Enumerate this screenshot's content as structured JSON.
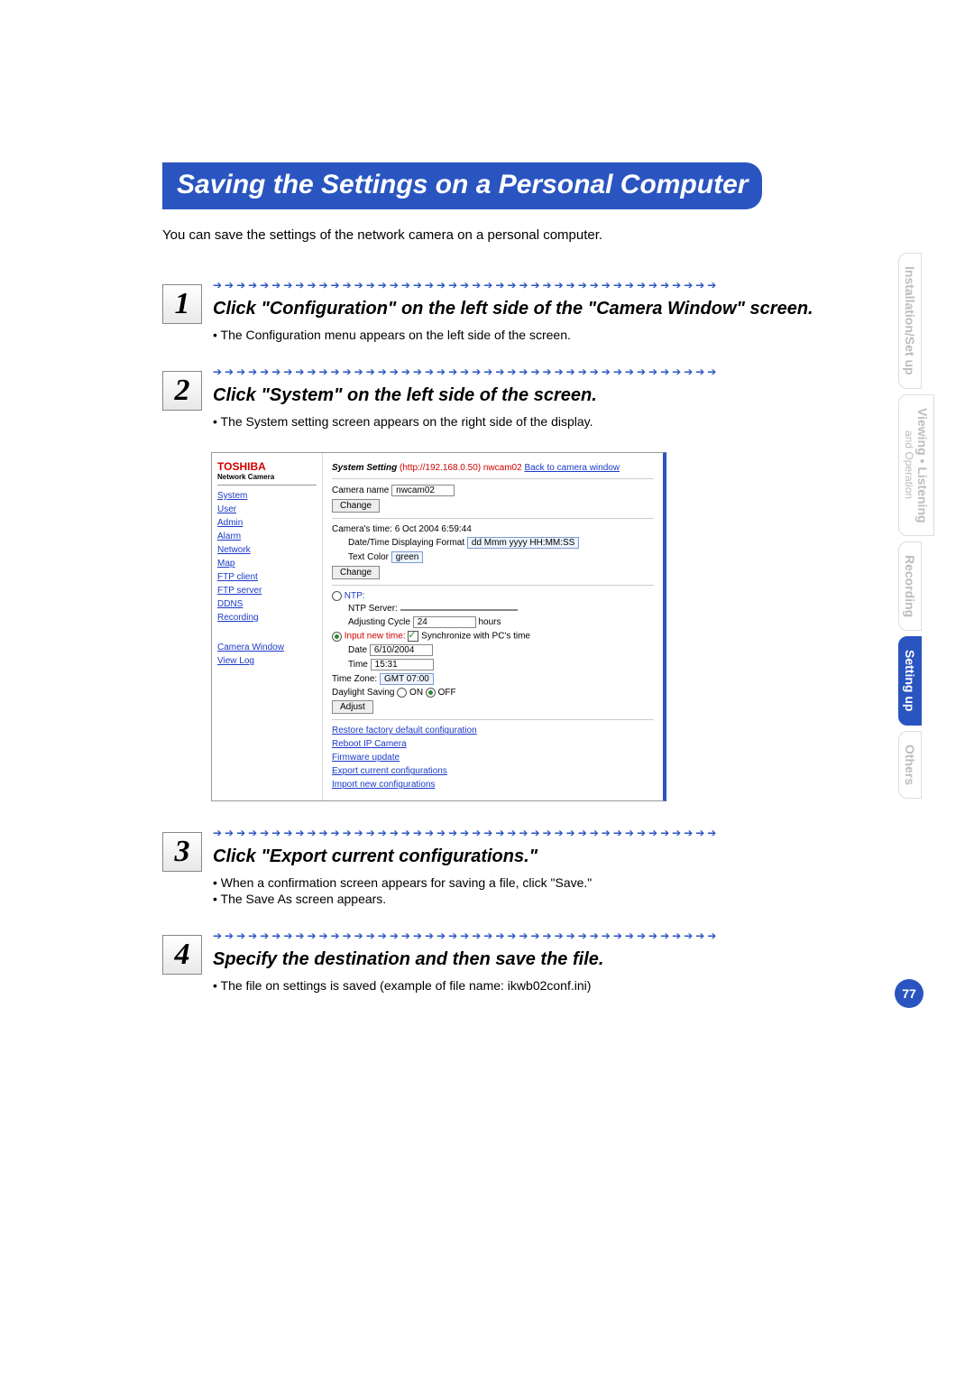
{
  "title": "Saving the Settings on a Personal Computer",
  "intro": "You can save the settings of the network camera on a personal computer.",
  "arrow_line": "➔➔➔➔➔➔➔➔➔➔➔➔➔➔➔➔➔➔➔➔➔➔➔➔➔➔➔➔➔➔➔➔➔➔➔➔➔➔➔➔➔➔➔",
  "steps": [
    {
      "num": "1",
      "title": "Click \"Configuration\" on the left side of the \"Camera Window\" screen.",
      "bullets": [
        "• The Configuration menu appears on the left side of the screen."
      ]
    },
    {
      "num": "2",
      "title": "Click \"System\" on the left side of the screen.",
      "bullets": [
        "• The System setting screen appears on the right side of the display."
      ]
    },
    {
      "num": "3",
      "title": "Click \"Export current configurations.\"",
      "bullets": [
        "• When a confirmation screen appears for saving a file, click \"Save.\"",
        "• The Save As screen appears."
      ]
    },
    {
      "num": "4",
      "title": "Specify the destination and then save the file.",
      "bullets": [
        "• The file on settings is saved (example of file name: ikwb02conf.ini)"
      ]
    }
  ],
  "screenshot": {
    "logo": "TOSHIBA",
    "logo_sub": "Network Camera",
    "side_links": [
      "System",
      "User",
      "Admin",
      "Alarm",
      "Network",
      "Map",
      "FTP client",
      "FTP server",
      "DDNS",
      "Recording",
      "",
      "Camera Window",
      "View Log"
    ],
    "header_label": "System Setting",
    "header_url": "(http://192.168.0.50) nwcam02",
    "header_back": "Back to camera window",
    "rows": {
      "camera_name_label": "Camera name",
      "camera_name_value": "nwcam02",
      "change_btn": "Change",
      "camera_time_label": "Camera's time:",
      "camera_time_value": "6 Oct 2004 6:59:44",
      "dt_format_label": "Date/Time Displaying Format",
      "dt_format_value": "dd Mmm yyyy HH:MM:SS",
      "text_color_label": "Text Color",
      "text_color_value": "green",
      "ntp_label": "NTP:",
      "ntp_server_label": "NTP Server:",
      "adjusting_label": "Adjusting Cycle",
      "adjusting_value": "24",
      "adjusting_unit": "hours",
      "input_new_label": "Input new time:",
      "sync_label": "Synchronize with PC's time",
      "date_label": "Date",
      "date_value": "6/10/2004",
      "time_label": "Time",
      "time_value": "15:31",
      "tz_label": "Time Zone:",
      "tz_value": "GMT 07:00",
      "daylight_label": "Daylight Saving",
      "on_label": "ON",
      "off_label": "OFF",
      "adjust_btn": "Adjust",
      "bottom_links": [
        "Restore factory default configuration",
        "Reboot IP Camera",
        "Firmware update",
        "Export current configurations",
        "Import new configurations"
      ]
    }
  },
  "side_tabs": [
    {
      "label": "Installation/Set up",
      "active": false
    },
    {
      "label": "Viewing • Listening",
      "sub": "and Operation",
      "active": false
    },
    {
      "label": "Recording",
      "active": false
    },
    {
      "label": "Setting up",
      "active": true
    },
    {
      "label": "Others",
      "active": false
    }
  ],
  "page_number": "77"
}
